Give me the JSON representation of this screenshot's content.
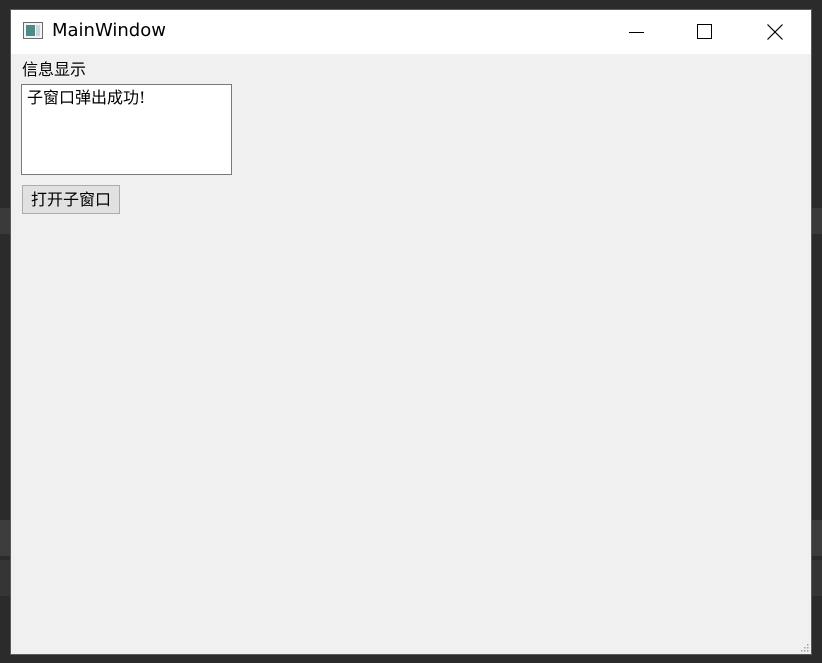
{
  "window": {
    "title": "MainWindow"
  },
  "main": {
    "info_label": "信息显示",
    "info_text": "子窗口弹出成功!",
    "open_button_label": "打开子窗口"
  },
  "icons": {
    "app": "app-window-icon",
    "minimize": "minimize-icon",
    "maximize": "maximize-icon",
    "close": "close-icon",
    "resize": "resize-grip-icon"
  },
  "colors": {
    "titlebar": "#ffffff",
    "client_bg": "#f0f0f0",
    "button_bg": "#e1e1e1",
    "button_border": "#adadad"
  }
}
